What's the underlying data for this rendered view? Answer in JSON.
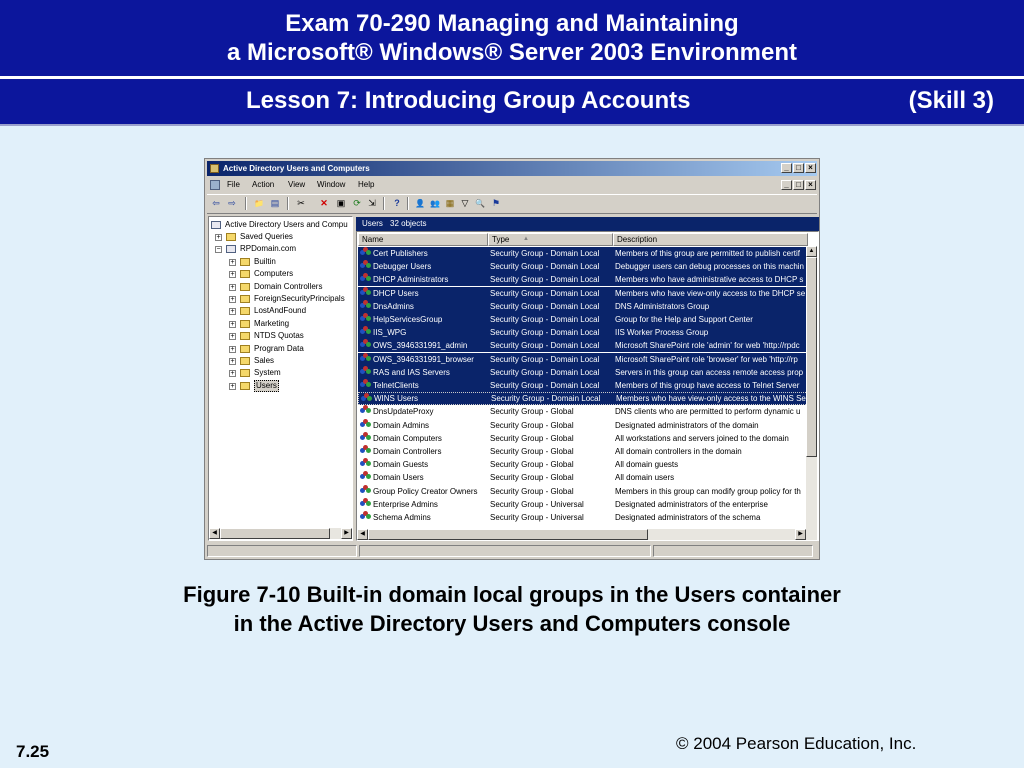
{
  "slide": {
    "title_line1": "Exam 70-290  Managing and Maintaining",
    "title_line2": "a Microsoft® Windows® Server 2003 Environment",
    "lesson": "Lesson 7: Introducing Group Accounts",
    "skill": "(Skill 3)",
    "caption_line1": "Figure 7-10 Built-in domain local groups in the Users container",
    "caption_line2": "in the Active Directory Users and Computers console",
    "copyright": "© 2004 Pearson Education, Inc.",
    "page_number": "7.25"
  },
  "window": {
    "title": "Active Directory Users and Computers",
    "title_buttons": [
      "_",
      "□",
      "×"
    ],
    "doc_buttons": [
      "_",
      "□",
      "×"
    ],
    "menu": [
      "File",
      "Action",
      "View",
      "Window",
      "Help"
    ],
    "toolbar_icons": [
      "back-icon",
      "forward-icon",
      "up-folder-icon",
      "show-hide-tree-icon",
      "cut-icon",
      "delete-icon",
      "properties-icon",
      "refresh-icon",
      "export-icon",
      "help-icon",
      "new-user-icon",
      "new-group-icon",
      "new-ou-icon",
      "filter-icon",
      "find-icon",
      "add-to-group-icon"
    ],
    "toolbar_glyphs": [
      "⇦",
      "⇨",
      "📁",
      "▤",
      "✂",
      "✕",
      "▣",
      "⟳",
      "⇲",
      "?",
      "👤",
      "👥",
      "▦",
      "▽",
      "🔍",
      "⚑"
    ]
  },
  "tree": {
    "root": "Active Directory Users and Compu",
    "items": [
      {
        "label": "Saved Queries",
        "level": 1,
        "expander": "+"
      },
      {
        "label": "RPDomain.com",
        "level": 1,
        "expander": "−"
      },
      {
        "label": "Builtin",
        "level": 2,
        "expander": "+"
      },
      {
        "label": "Computers",
        "level": 2,
        "expander": "+"
      },
      {
        "label": "Domain Controllers",
        "level": 2,
        "expander": "+"
      },
      {
        "label": "ForeignSecurityPrincipals",
        "level": 2,
        "expander": "+"
      },
      {
        "label": "LostAndFound",
        "level": 2,
        "expander": "+"
      },
      {
        "label": "Marketing",
        "level": 2,
        "expander": "+"
      },
      {
        "label": "NTDS Quotas",
        "level": 2,
        "expander": "+"
      },
      {
        "label": "Program Data",
        "level": 2,
        "expander": "+"
      },
      {
        "label": "Sales",
        "level": 2,
        "expander": "+"
      },
      {
        "label": "System",
        "level": 2,
        "expander": "+"
      },
      {
        "label": "Users",
        "level": 2,
        "expander": "+",
        "selected": true
      }
    ]
  },
  "list": {
    "container": "Users",
    "count": "32 objects",
    "columns": [
      "Name",
      "Type",
      "Description"
    ],
    "sort_indicator": "▲",
    "rows": [
      {
        "name": "Cert Publishers",
        "type": "Security Group - Domain Local",
        "description": "Members of this group are permitted to publish certif",
        "selected": true
      },
      {
        "name": "Debugger Users",
        "type": "Security Group - Domain Local",
        "description": "Debugger users can debug processes on this machin",
        "selected": true
      },
      {
        "name": "DHCP Administrators",
        "type": "Security Group - Domain Local",
        "description": "Members who have administrative access to DHCP s",
        "selected": true
      },
      {
        "name": "DHCP Users",
        "type": "Security Group - Domain Local",
        "description": "Members who have view-only access to the DHCP se",
        "selected": true
      },
      {
        "name": "DnsAdmins",
        "type": "Security Group - Domain Local",
        "description": "DNS Administrators Group",
        "selected": true
      },
      {
        "name": "HelpServicesGroup",
        "type": "Security Group - Domain Local",
        "description": "Group for the Help and Support Center",
        "selected": true
      },
      {
        "name": "IIS_WPG",
        "type": "Security Group - Domain Local",
        "description": "IIS Worker Process Group",
        "selected": true
      },
      {
        "name": "OWS_3946331991_admin",
        "type": "Security Group - Domain Local",
        "description": "Microsoft SharePoint role 'admin' for web 'http://rpdc",
        "selected": true
      },
      {
        "name": "OWS_3946331991_browser",
        "type": "Security Group - Domain Local",
        "description": "Microsoft SharePoint role 'browser' for web 'http://rp",
        "selected": true
      },
      {
        "name": "RAS and IAS Servers",
        "type": "Security Group - Domain Local",
        "description": "Servers in this group can access remote access prop",
        "selected": true
      },
      {
        "name": "TelnetClients",
        "type": "Security Group - Domain Local",
        "description": "Members of this group have access to Telnet Server",
        "selected": true
      },
      {
        "name": "WINS Users",
        "type": "Security Group - Domain Local",
        "description": "Members who have view-only access to the WINS Se",
        "selected": true,
        "focused": true
      },
      {
        "name": "DnsUpdateProxy",
        "type": "Security Group - Global",
        "description": "DNS clients who are permitted to perform dynamic u",
        "selected": false
      },
      {
        "name": "Domain Admins",
        "type": "Security Group - Global",
        "description": "Designated administrators of the domain",
        "selected": false
      },
      {
        "name": "Domain Computers",
        "type": "Security Group - Global",
        "description": "All workstations and servers joined to the domain",
        "selected": false
      },
      {
        "name": "Domain Controllers",
        "type": "Security Group - Global",
        "description": "All domain controllers in the domain",
        "selected": false
      },
      {
        "name": "Domain Guests",
        "type": "Security Group - Global",
        "description": "All domain guests",
        "selected": false
      },
      {
        "name": "Domain Users",
        "type": "Security Group - Global",
        "description": "All domain users",
        "selected": false
      },
      {
        "name": "Group Policy Creator Owners",
        "type": "Security Group - Global",
        "description": "Members in this group can modify group policy for th",
        "selected": false
      },
      {
        "name": "Enterprise Admins",
        "type": "Security Group - Universal",
        "description": "Designated administrators of the enterprise",
        "selected": false
      },
      {
        "name": "Schema Admins",
        "type": "Security Group - Universal",
        "description": "Designated administrators of the schema",
        "selected": false
      }
    ]
  },
  "colors": {
    "slide_banner": "#0c169c",
    "slide_background": "#e1f0fa",
    "selection": "#0a246a"
  }
}
